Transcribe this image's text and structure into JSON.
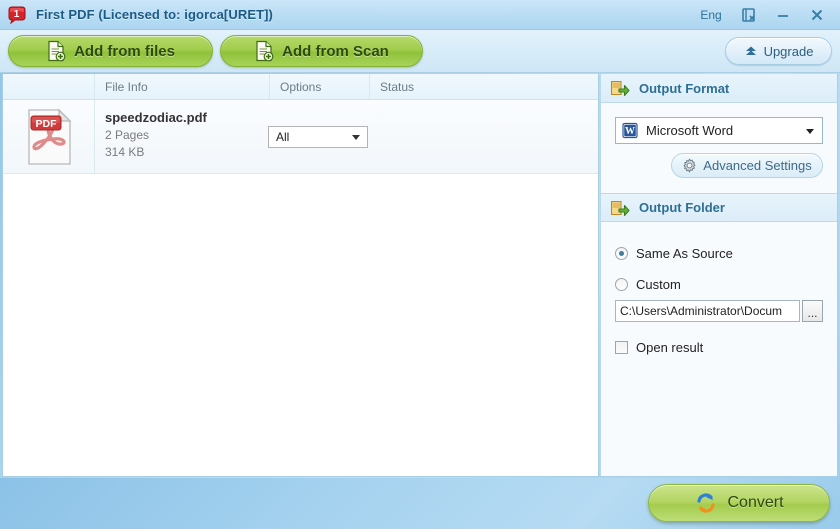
{
  "window": {
    "title": "First PDF (Licensed to: igorca[URET])",
    "app_icon": "app-badge-icon",
    "controls": {
      "language": "Eng",
      "help_icon": "help-book-icon",
      "minimize_icon": "minimize-icon",
      "close_icon": "close-icon"
    }
  },
  "toolbar": {
    "add_from_files": "Add from files",
    "add_from_scan": "Add from Scan",
    "upgrade": "Upgrade",
    "icons": {
      "add_files": "document-add-icon",
      "add_scan": "document-scan-add-icon",
      "upgrade": "double-chevron-up-icon"
    }
  },
  "file_list": {
    "columns": [
      "",
      "File Info",
      "Options",
      "Status"
    ],
    "rows": [
      {
        "icon": "pdf-file-icon",
        "name": "speedzodiac.pdf",
        "pages": "2 Pages",
        "size": "314 KB",
        "option_value": "All",
        "status": ""
      }
    ]
  },
  "output_format": {
    "heading": "Output Format",
    "heading_icon": "export-document-icon",
    "selected": "Microsoft Word",
    "selected_icon": "word-icon",
    "advanced_settings": "Advanced Settings",
    "advanced_icon": "gear-icon"
  },
  "output_folder": {
    "heading": "Output Folder",
    "heading_icon": "export-folder-icon",
    "same_as_source": "Same As Source",
    "same_as_source_selected": true,
    "custom": "Custom",
    "custom_selected": false,
    "path_value": "C:\\Users\\Administrator\\Docum",
    "browse_label": "...",
    "open_result": "Open result",
    "open_result_checked": false
  },
  "footer": {
    "convert": "Convert",
    "convert_icon": "refresh-arrows-icon"
  },
  "colors": {
    "title_bar": "#bcdef5",
    "title_text": "#1c5b86",
    "accent_green": "#a2cd4e",
    "panel_bg": "#f8fbfe",
    "section_head_text": "#2e6f95",
    "desktop": "#a5d2ef"
  }
}
